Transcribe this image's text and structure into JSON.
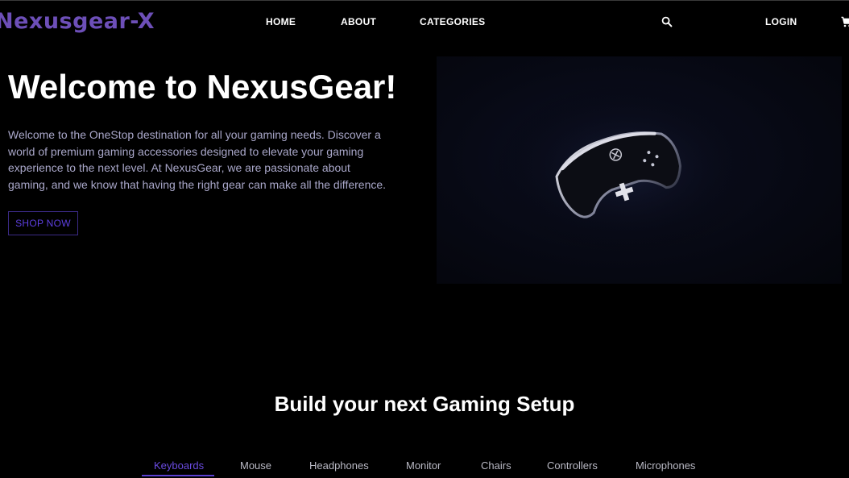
{
  "brand": {
    "logo_text": "Nexusgear-X",
    "accent_color": "#6d4fb8"
  },
  "nav": {
    "home": "HOME",
    "about": "ABOUT",
    "categories": "CATEGORIES",
    "login": "LOGIN",
    "search_icon": "search-icon",
    "cart_icon": "cart-icon"
  },
  "hero": {
    "title": "Welcome to NexusGear!",
    "description": "Welcome to the OneStop destination for all your gaming needs. Discover a world of premium gaming accessories designed to elevate your gaming experience to the next level. At NexusGear, we are passionate about gaming, and we know that having the right gear can make all the difference.",
    "cta_label": "SHOP NOW",
    "cta_color": "#5d3fe0"
  },
  "setup_section": {
    "title": "Build your next Gaming Setup",
    "tabs": [
      {
        "label": "Keyboards",
        "active": true
      },
      {
        "label": "Mouse",
        "active": false
      },
      {
        "label": "Headphones",
        "active": false
      },
      {
        "label": "Monitor",
        "active": false
      },
      {
        "label": "Chairs",
        "active": false
      },
      {
        "label": "Controllers",
        "active": false
      },
      {
        "label": "Microphones",
        "active": false
      }
    ]
  }
}
